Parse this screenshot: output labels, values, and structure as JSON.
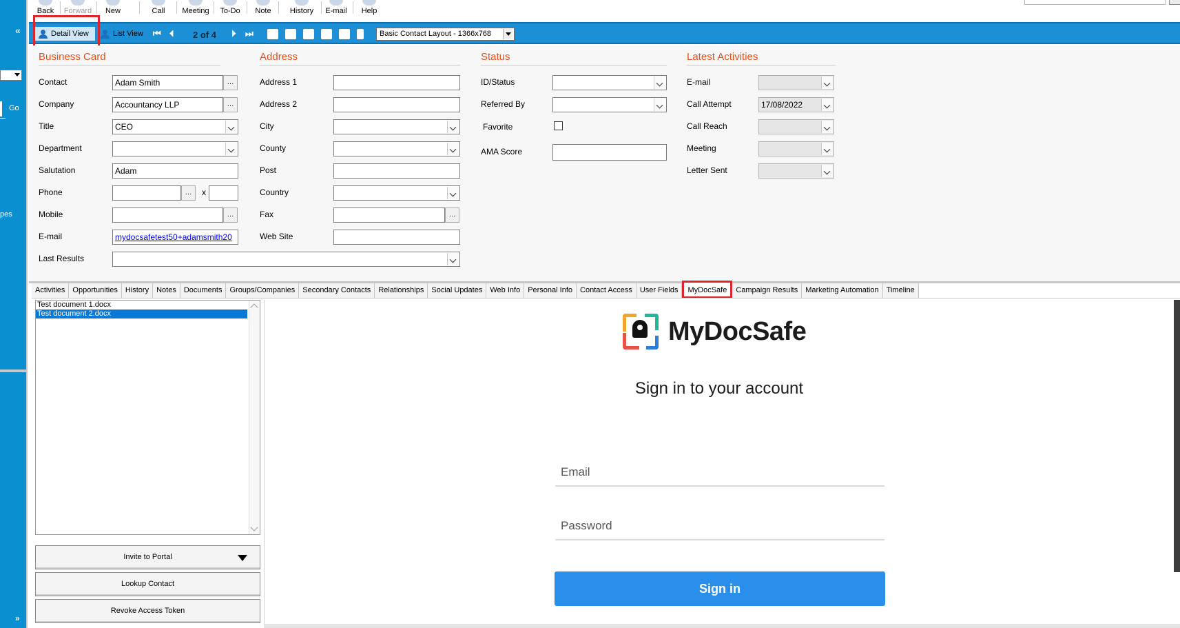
{
  "toolbar": {
    "buttons": [
      {
        "label": "Back",
        "enabled": true
      },
      {
        "label": "Forward",
        "enabled": false
      },
      {
        "label": "New",
        "enabled": true
      },
      {
        "label": "Call",
        "enabled": true
      },
      {
        "label": "Meeting",
        "enabled": true
      },
      {
        "label": "To-Do",
        "enabled": true
      },
      {
        "label": "Note",
        "enabled": true
      },
      {
        "label": "History",
        "enabled": true
      },
      {
        "label": "E-mail",
        "enabled": true
      },
      {
        "label": "Help",
        "enabled": true
      }
    ]
  },
  "sidebar": {
    "go_label": "Go",
    "partial_label": "pes",
    "collapse_icon": "double-chevron-left-icon",
    "expand_icon": "double-chevron-down-icon"
  },
  "navbar": {
    "detail_view_label": "Detail View",
    "list_view_label": "List View",
    "record_position": "2 of 4",
    "layout_selected": "Basic Contact Layout - 1366x768"
  },
  "business_card": {
    "title": "Business Card",
    "fields": {
      "contact": {
        "label": "Contact",
        "value": "Adam Smith"
      },
      "company": {
        "label": "Company",
        "value": "Accountancy LLP"
      },
      "title": {
        "label": "Title",
        "value": "CEO"
      },
      "department": {
        "label": "Department",
        "value": ""
      },
      "salutation": {
        "label": "Salutation",
        "value": "Adam"
      },
      "phone": {
        "label": "Phone",
        "value": "",
        "ext_label": "x",
        "ext_value": ""
      },
      "mobile": {
        "label": "Mobile",
        "value": ""
      },
      "email": {
        "label": "E-mail",
        "value": "mydocsafetest50+adamsmith20"
      },
      "last_results": {
        "label": "Last Results",
        "value": ""
      }
    }
  },
  "address": {
    "title": "Address",
    "fields": {
      "address1": {
        "label": "Address 1",
        "value": ""
      },
      "address2": {
        "label": "Address 2",
        "value": ""
      },
      "city": {
        "label": "City",
        "value": ""
      },
      "county": {
        "label": "County",
        "value": ""
      },
      "post": {
        "label": "Post",
        "value": ""
      },
      "country": {
        "label": "Country",
        "value": ""
      },
      "fax": {
        "label": "Fax",
        "value": ""
      },
      "website": {
        "label": "Web Site",
        "value": ""
      }
    }
  },
  "status": {
    "title": "Status",
    "fields": {
      "id_status": {
        "label": "ID/Status",
        "value": ""
      },
      "referred_by": {
        "label": "Referred By",
        "value": ""
      },
      "favorite": {
        "label": "Favorite",
        "checked": false
      },
      "ama_score": {
        "label": "AMA Score",
        "value": ""
      }
    }
  },
  "latest_activities": {
    "title": "Latest Activities",
    "fields": {
      "email": {
        "label": "E-mail",
        "value": ""
      },
      "call_attempt": {
        "label": "Call Attempt",
        "value": "17/08/2022"
      },
      "call_reach": {
        "label": "Call Reach",
        "value": ""
      },
      "meeting": {
        "label": "Meeting",
        "value": ""
      },
      "letter_sent": {
        "label": "Letter Sent",
        "value": ""
      }
    }
  },
  "tabs": [
    "Activities",
    "Opportunities",
    "History",
    "Notes",
    "Documents",
    "Groups/Companies",
    "Secondary Contacts",
    "Relationships",
    "Social Updates",
    "Web Info",
    "Personal Info",
    "Contact Access",
    "User Fields",
    "MyDocSafe",
    "Campaign Results",
    "Marketing Automation",
    "Timeline"
  ],
  "active_tab": "MyDocSafe",
  "documents": {
    "items": [
      {
        "name": "Test document 1.docx",
        "selected": false
      },
      {
        "name": "Test document 2.docx",
        "selected": true
      }
    ],
    "buttons": {
      "invite": "Invite to Portal",
      "lookup": "Lookup Contact",
      "revoke": "Revoke Access Token"
    }
  },
  "mydocsafe": {
    "logo_text": "MyDocSafe",
    "heading": "Sign in to your account",
    "email_placeholder": "Email",
    "password_placeholder": "Password",
    "signin_label": "Sign in",
    "colors": {
      "button": "#2a8fea",
      "logo_orange": "#f2a52c",
      "logo_green": "#27b59a",
      "logo_red": "#e8524a",
      "logo_blue": "#2d7fd6"
    }
  },
  "colors": {
    "sidebar_blue": "#0a8fd0",
    "navbar_blue": "#1d8fd5",
    "section_title_orange": "#e4501b",
    "highlight_red": "#e0242b",
    "selection_blue": "#0a78d7"
  }
}
